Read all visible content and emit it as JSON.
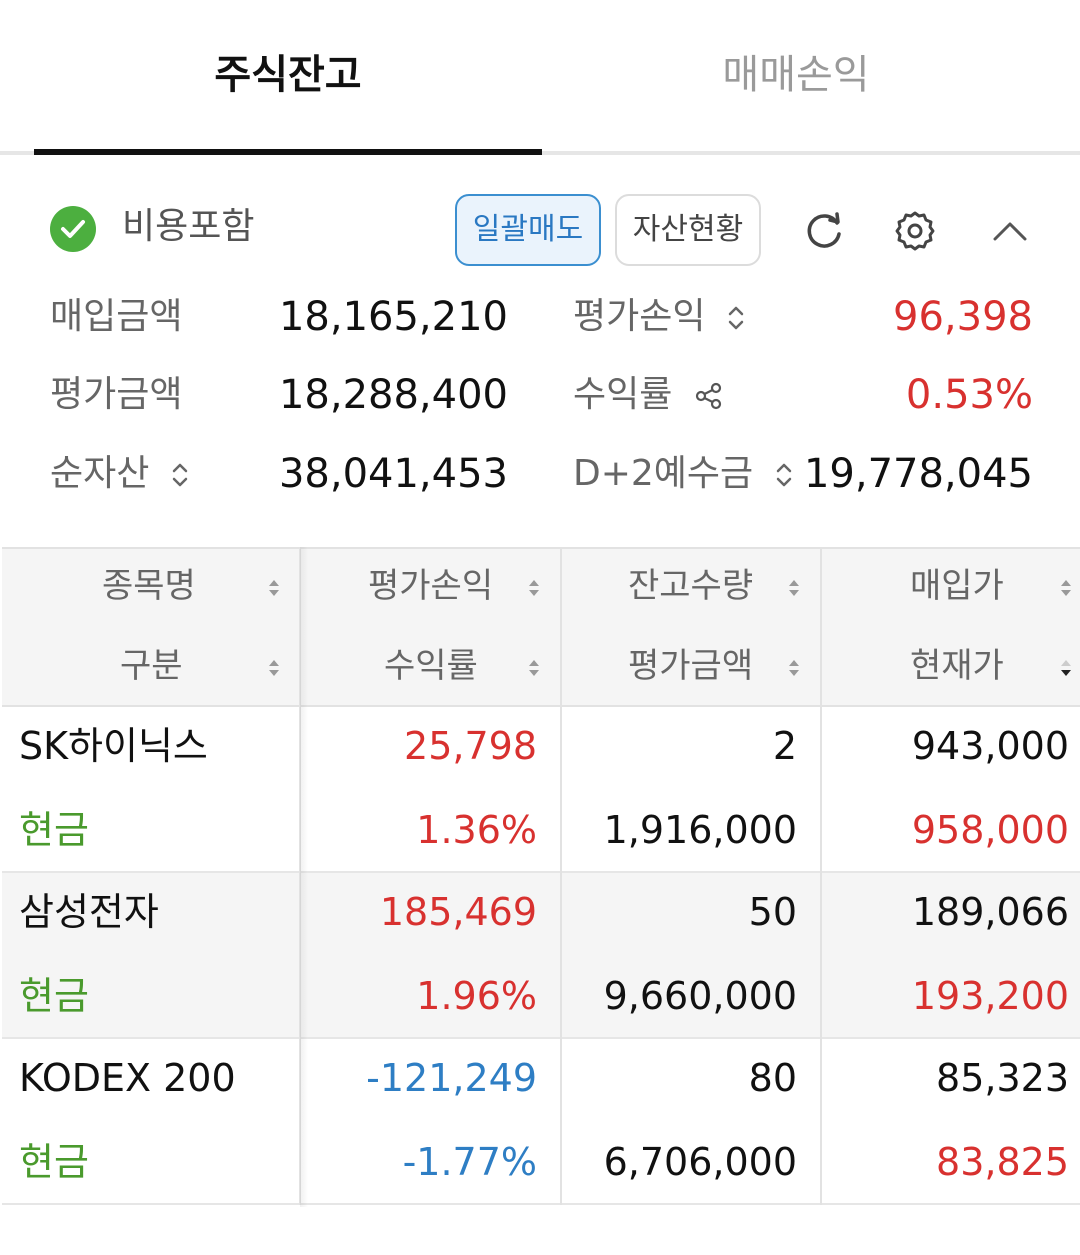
{
  "tabs": {
    "active": "주식잔고",
    "inactive": "매매손익"
  },
  "toolbar": {
    "fee_label": "비용포함",
    "sell_all_label": "일괄매도",
    "assets_label": "자산현황"
  },
  "summary": {
    "purchase_amount_label": "매입금액",
    "purchase_amount_value": "18,165,210",
    "eval_amount_label": "평가금액",
    "eval_amount_value": "18,288,400",
    "net_assets_label": "순자산",
    "net_assets_value": "38,041,453",
    "eval_pl_label": "평가손익",
    "eval_pl_value": "96,398",
    "return_label": "수익률",
    "return_value": "0.53%",
    "deposit_label": "D+2예수금",
    "deposit_value": "19,778,045"
  },
  "table": {
    "headers": {
      "name": "종목명",
      "type": "구분",
      "eval_pl": "평가손익",
      "return": "수익률",
      "quantity": "잔고수량",
      "eval_amount": "평가금액",
      "buy_price": "매입가",
      "current_price": "현재가"
    },
    "rows": [
      {
        "name": "SK하이닉스",
        "type": "현금",
        "eval_pl": "25,798",
        "return": "1.36%",
        "quantity": "2",
        "eval_amount": "1,916,000",
        "buy_price": "943,000",
        "current_price": "958,000",
        "sign": "up"
      },
      {
        "name": "삼성전자",
        "type": "현금",
        "eval_pl": "185,469",
        "return": "1.96%",
        "quantity": "50",
        "eval_amount": "9,660,000",
        "buy_price": "189,066",
        "current_price": "193,200",
        "sign": "up"
      },
      {
        "name": "KODEX 200",
        "type": "현금",
        "eval_pl": "-121,249",
        "return": "-1.77%",
        "quantity": "80",
        "eval_amount": "6,706,000",
        "buy_price": "85,323",
        "current_price": "83,825",
        "sign": "down"
      }
    ]
  },
  "colors": {
    "up": "#d8312f",
    "down": "#2e7ec4",
    "cash": "#4a9a2d",
    "accent": "#2a78c2",
    "check": "#4caf3f"
  }
}
